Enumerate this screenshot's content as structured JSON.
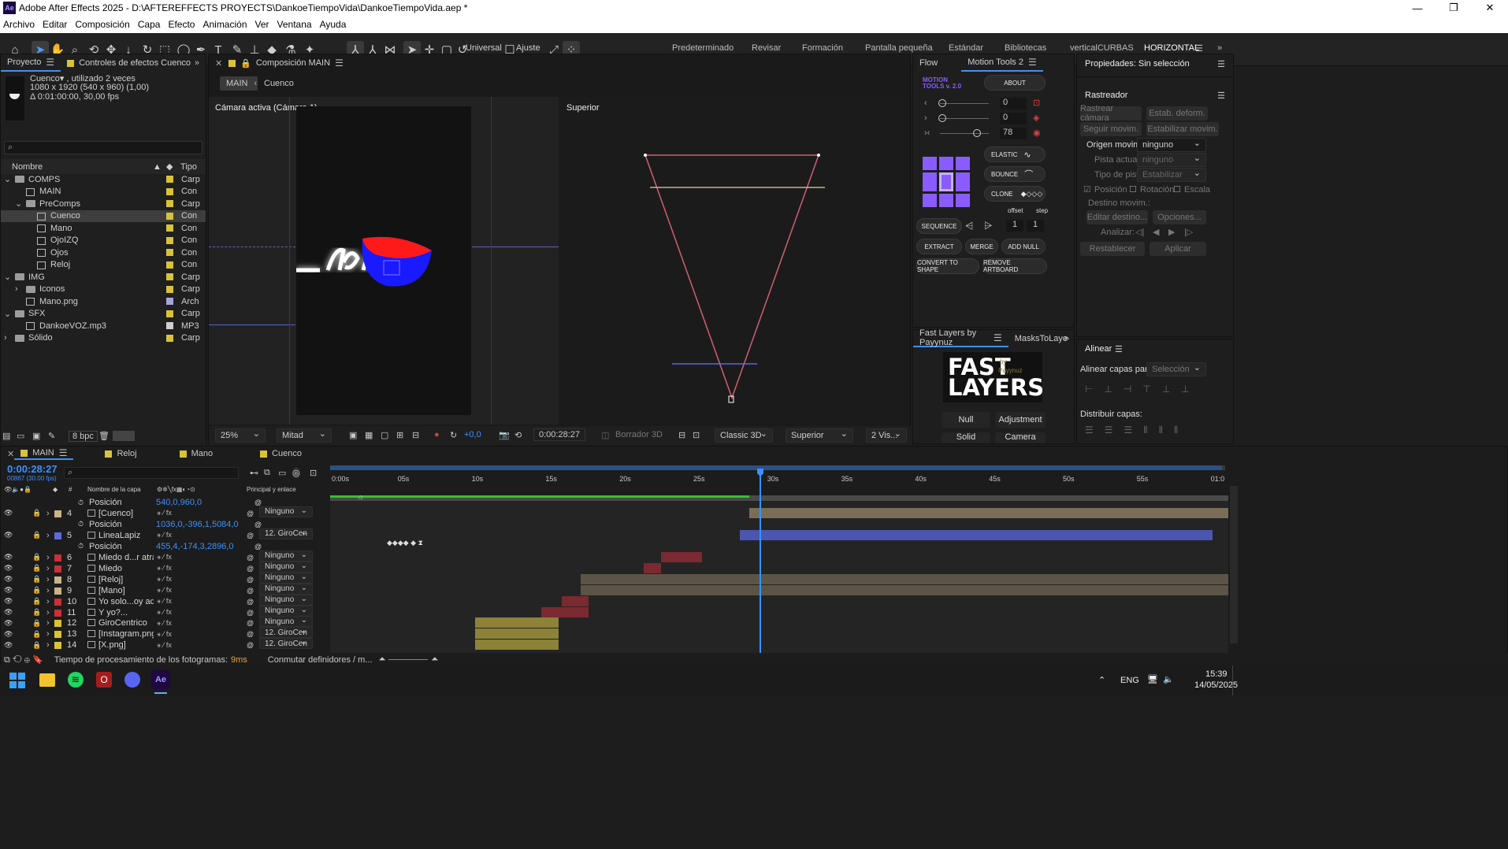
{
  "window": {
    "title": "Adobe After Effects 2025 - D:\\AFTEREFFECTS PROYECTS\\DankoeTiempoVida\\DankoeTiempoVida.aep *",
    "app_icon": "Ae",
    "minimize": "—",
    "maximize": "❐",
    "close": "✕"
  },
  "menu": [
    "Archivo",
    "Editar",
    "Composición",
    "Capa",
    "Efecto",
    "Animación",
    "Ver",
    "Ventana",
    "Ayuda"
  ],
  "toolbar": {
    "universal_label": "Universal",
    "ajuste_label": "Ajuste",
    "workspaces": [
      "Predeterminado",
      "Revisar",
      "Formación",
      "Pantalla pequeña",
      "Estándar",
      "Bibliotecas",
      "verticalCURBAS",
      "HORIZONTAL"
    ],
    "active_workspace": "HORIZONTAL"
  },
  "project": {
    "tab_project": "Proyecto",
    "tab_effects": "Controles de efectos Cuenco",
    "selected_name": "Cuenco▾ , utilizado 2 veces",
    "selected_dims": "1080 x 1920  (540 x 960) (1,00)",
    "selected_duration": "Δ 0:01:00:00, 30,00 fps",
    "search_placeholder": "",
    "col_name": "Nombre",
    "col_type": "Tipo",
    "items": [
      {
        "name": "COMPS",
        "type": "Carp",
        "color": "#d8c23a",
        "kind": "folder",
        "indent": 0,
        "twirl": "⌄"
      },
      {
        "name": "MAIN",
        "type": "Con",
        "color": "#d8c23a",
        "kind": "comp",
        "indent": 1,
        "twirl": ""
      },
      {
        "name": "PreComps",
        "type": "Carp",
        "color": "#d8c23a",
        "kind": "folder",
        "indent": 1,
        "twirl": "⌄"
      },
      {
        "name": "Cuenco",
        "type": "Con",
        "color": "#d8c23a",
        "kind": "comp",
        "indent": 2,
        "twirl": "",
        "selected": true
      },
      {
        "name": "Mano",
        "type": "Con",
        "color": "#d8c23a",
        "kind": "comp",
        "indent": 2,
        "twirl": ""
      },
      {
        "name": "OjoIZQ",
        "type": "Con",
        "color": "#d8c23a",
        "kind": "comp",
        "indent": 2,
        "twirl": ""
      },
      {
        "name": "Ojos",
        "type": "Con",
        "color": "#d8c23a",
        "kind": "comp",
        "indent": 2,
        "twirl": ""
      },
      {
        "name": "Reloj",
        "type": "Con",
        "color": "#d8c23a",
        "kind": "comp",
        "indent": 2,
        "twirl": ""
      },
      {
        "name": "IMG",
        "type": "Carp",
        "color": "#d8c23a",
        "kind": "folder",
        "indent": 0,
        "twirl": "⌄"
      },
      {
        "name": "Iconos",
        "type": "Carp",
        "color": "#d8c23a",
        "kind": "folder",
        "indent": 1,
        "twirl": "›"
      },
      {
        "name": "Mano.png",
        "type": "Arch",
        "color": "#a5a5d8",
        "kind": "file",
        "indent": 1,
        "twirl": ""
      },
      {
        "name": "SFX",
        "type": "Carp",
        "color": "#d8c23a",
        "kind": "folder",
        "indent": 0,
        "twirl": "⌄"
      },
      {
        "name": "DankoeVOZ.mp3",
        "type": "MP3",
        "color": "#cfcfcf",
        "kind": "file",
        "indent": 1,
        "twirl": ""
      },
      {
        "name": "Sólido",
        "type": "Carp",
        "color": "#d8c23a",
        "kind": "folder",
        "indent": 0,
        "twirl": "›"
      }
    ],
    "bpc": "8 bpc"
  },
  "composition": {
    "tab": "Composición MAIN",
    "crumb_main": "MAIN",
    "crumb_cuenco": "Cuenco",
    "left_view_label": "Cámara activa (Cámara 1)",
    "right_view_label": "Superior",
    "zoom": "25%",
    "resolution": "Mitad",
    "exposure": "+0,0",
    "timecode": "0:00:28:27",
    "draft3d": "Borrador 3D",
    "renderer": "Classic 3D",
    "view": "Superior",
    "views": "2 Vis..."
  },
  "motion_tools": {
    "tab_flow": "Flow",
    "tab_mt": "Motion Tools 2",
    "logo_line1": "MOTION",
    "logo_line2": "TOOLS v. 2.0",
    "about": "ABOUT",
    "slider1": "0",
    "slider2": "0",
    "slider3": "78",
    "elastic": "ELASTIC",
    "bounce": "BOUNCE",
    "clone": "CLONE",
    "offset": "offset",
    "step": "step",
    "sequence": "SEQUENCE",
    "offset_val": "1",
    "step_val": "1",
    "extract": "EXTRACT",
    "merge": "MERGE",
    "add_null": "ADD NULL",
    "convert": "CONVERT TO SHAPE",
    "remove_artboard": "REMOVE ARTBOARD"
  },
  "fast_layers": {
    "tab": "Fast Layers by Payynuz",
    "tab2": "MasksToLaye",
    "logo_line1": "FAST",
    "logo_line2": "LAYERS",
    "logo_by": "by",
    "logo_author": "Payynuz",
    "null_btn": "Null",
    "adjustment_btn": "Adjustment",
    "solid_btn": "Solid",
    "camera_btn": "Camera"
  },
  "properties": {
    "title": "Propiedades: Sin selección",
    "tracker_title": "Rastreador",
    "track_camera": "Rastrear cámara",
    "warp_stab": "Estab. deform.",
    "track_motion": "Seguir movim.",
    "stabilize_motion": "Estabilizar movim.",
    "motion_source_label": "Origen movim.:",
    "motion_source_value": "ninguno",
    "current_track_label": "Pista actual:",
    "current_track_value": "ninguno",
    "track_type_label": "Tipo de pista:",
    "track_type_value": "Estabilizar",
    "position": "Posición",
    "rotation": "Rotación",
    "scale": "Escala",
    "motion_target": "Destino movim.:",
    "edit_target": "Editar destino...",
    "options": "Opciones...",
    "analyze": "Analizar:",
    "reset": "Restablecer",
    "apply": "Aplicar",
    "align_title": "Alinear",
    "align_layers_to": "Alinear capas para:",
    "selection": "Selección",
    "distribute_layers": "Distribuir capas:"
  },
  "timeline": {
    "tabs": [
      "MAIN",
      "Reloj",
      "Mano",
      "Cuenco"
    ],
    "timecode": "0:00:28:27",
    "frames": "00867 (30.00 fps)",
    "col_layer_name": "Nombre de la capa",
    "col_parent": "Principal y enlace",
    "ruler": [
      "0:00s",
      "05s",
      "10s",
      "15s",
      "20s",
      "25s",
      "30s",
      "35s",
      "40s",
      "45s",
      "50s",
      "55s",
      "01:0"
    ],
    "rows": [
      {
        "num": "",
        "name": "Posición",
        "kind": "prop",
        "value": "540,0,960,0",
        "parent": "",
        "color": ""
      },
      {
        "num": "4",
        "name": "[Cuenco]",
        "kind": "layer",
        "value": "",
        "parent": "Ninguno",
        "color": "#c8b48a"
      },
      {
        "num": "",
        "name": "Posición",
        "kind": "prop",
        "value": "1036,0,-396,1,5084,0",
        "parent": "",
        "color": ""
      },
      {
        "num": "5",
        "name": "LineaLapiz",
        "kind": "layer",
        "value": "",
        "parent": "12. GiroCen",
        "color": "#5d6bd8"
      },
      {
        "num": "",
        "name": "Posición",
        "kind": "prop",
        "value": "455,4,-174,3,2896,0",
        "parent": "",
        "color": ""
      },
      {
        "num": "6",
        "name": "Miedo d...r atras",
        "kind": "layer",
        "value": "",
        "parent": "Ninguno",
        "color": "#c8303a"
      },
      {
        "num": "7",
        "name": "Miedo",
        "kind": "layer",
        "value": "",
        "parent": "Ninguno",
        "color": "#c8303a"
      },
      {
        "num": "8",
        "name": "[Reloj]",
        "kind": "layer",
        "value": "",
        "parent": "Ninguno",
        "color": "#c8b48a"
      },
      {
        "num": "9",
        "name": "[Mano]",
        "kind": "layer",
        "value": "",
        "parent": "Ninguno",
        "color": "#c8b48a"
      },
      {
        "num": "10",
        "name": "Yo solo...oy aquí.",
        "kind": "layer",
        "value": "",
        "parent": "Ninguno",
        "color": "#c8303a"
      },
      {
        "num": "11",
        "name": "Y yo?...",
        "kind": "layer",
        "value": "",
        "parent": "Ninguno",
        "color": "#c8303a"
      },
      {
        "num": "12",
        "name": "GiroCentrico",
        "kind": "layer",
        "value": "",
        "parent": "Ninguno",
        "color": "#d8c23a"
      },
      {
        "num": "13",
        "name": "[Instagram.png]",
        "kind": "layer",
        "value": "",
        "parent": "12. GiroCen",
        "color": "#d8c23a"
      },
      {
        "num": "14",
        "name": "[X.png]",
        "kind": "layer",
        "value": "",
        "parent": "12. GiroCen",
        "color": "#d8c23a"
      }
    ],
    "status_left": "Tiempo de procesamiento de los fotogramas:",
    "status_ms": "9ms",
    "status_toggle": "Conmutar definidores / m..."
  },
  "taskbar": {
    "lang": "ENG",
    "time": "15:39",
    "date": "14/05/2025"
  },
  "colors": {
    "accent_blue": "#3c91ff",
    "bowl_red": "#ff1a1a",
    "bowl_blue": "#1a1aff",
    "purple": "#8a5cff"
  }
}
